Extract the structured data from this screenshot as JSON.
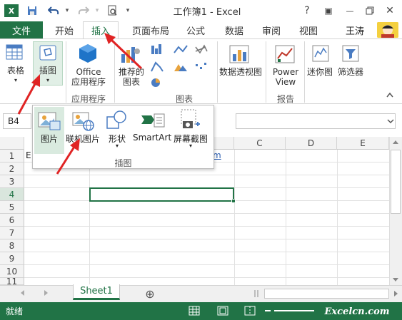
{
  "window": {
    "title": "工作簿1 - Excel",
    "app_icon": "X",
    "help": "?",
    "restore": "▣",
    "minimize": "—",
    "close": "✕"
  },
  "qat": {
    "save_icon": "save-icon",
    "undo_icon": "undo-icon",
    "redo_icon": "redo-icon",
    "preview_icon": "print-preview-icon",
    "more": "▾"
  },
  "tabs": {
    "file": "文件",
    "items": [
      "开始",
      "插入",
      "页面布局",
      "公式",
      "数据",
      "审阅",
      "视图"
    ],
    "active": "插入",
    "user": "王涛"
  },
  "ribbon": {
    "table": "表格",
    "illustrations": "插图",
    "office_apps": "Office\n应用程序",
    "apps_group": "应用程序",
    "recommended_charts": "推荐的\n图表",
    "charts_group": "图表",
    "pivot_chart": "数据透视图",
    "power_view": "Power\nView",
    "reports_group": "报告",
    "sparklines": "迷你图",
    "filters": "筛选器"
  },
  "formula_bar": {
    "name_box": "B4"
  },
  "illustrations_panel": {
    "items": [
      "图片",
      "联机图片",
      "形状",
      "SmartArt",
      "屏幕截图"
    ],
    "group_label": "插图"
  },
  "grid": {
    "columns": [
      "C",
      "D",
      "E"
    ],
    "rows": [
      "1",
      "2",
      "3",
      "4",
      "5",
      "6",
      "7",
      "8",
      "9",
      "10",
      "11"
    ],
    "selected_row": "4",
    "a1_partial": "E",
    "b1_partial": "m"
  },
  "sheet": {
    "name": "Sheet1",
    "add": "⊕"
  },
  "status": {
    "text": "就绪",
    "watermark": "Excelcn.com"
  },
  "colors": {
    "accent": "#217346",
    "arrow": "#e02424"
  }
}
